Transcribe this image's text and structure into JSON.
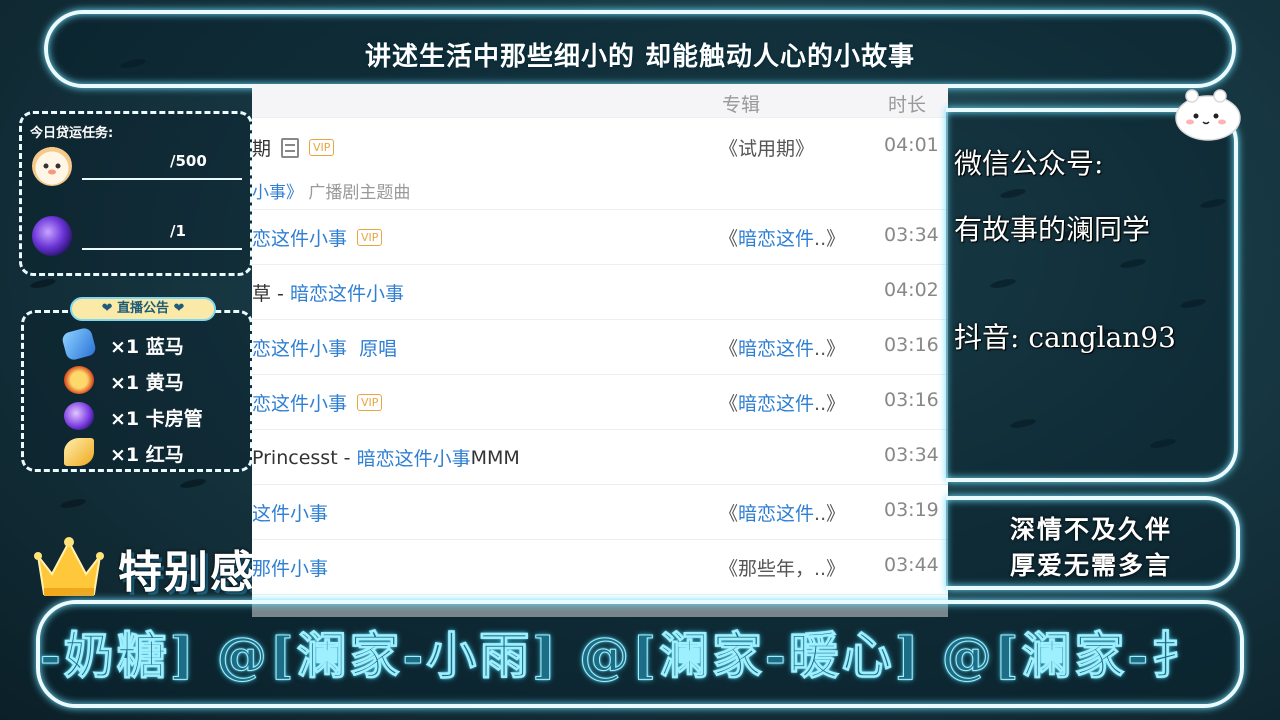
{
  "top_banner": {
    "title": "讲述生活中那些细小的 却能触动人心的小故事"
  },
  "task_panel": {
    "title": "今日贷运任务:",
    "rows": [
      {
        "icon": "chick-avatar-icon",
        "count": "/500"
      },
      {
        "icon": "purple-orb-icon",
        "count": "/1"
      }
    ]
  },
  "notice_panel": {
    "badge": "❤ 直播公告 ❤",
    "items": [
      {
        "icon": "ticket-icon",
        "text": "×1 蓝马"
      },
      {
        "icon": "crown-gift-icon",
        "text": "×1 黄马"
      },
      {
        "icon": "purple-gem-icon",
        "text": "×1 卡房管"
      },
      {
        "icon": "wing-icon",
        "text": "×1 红马"
      }
    ]
  },
  "special": {
    "label": "特别感"
  },
  "music_list": {
    "header": {
      "album": "专辑",
      "duration": "时长"
    },
    "rows": [
      {
        "title_plain": "期",
        "title_blue": "",
        "title_suffix": "",
        "vip": "VIP",
        "mv": true,
        "subtitle_blue": "小事》",
        "subtitle_gray": "广播剧主题曲",
        "album_plain": "《试用期》",
        "album_blue": "",
        "album_suffix": "",
        "duration": "04:01"
      },
      {
        "title_plain": "",
        "title_blue": "恋这件小事",
        "title_suffix": "",
        "vip": "VIP",
        "album_plain": "《",
        "album_blue": "暗恋这件",
        "album_suffix": "..》",
        "duration": "03:34"
      },
      {
        "title_plain": "草 - ",
        "title_blue": "暗恋这件小事",
        "title_suffix": "",
        "vip": "",
        "album_plain": "",
        "album_blue": "",
        "album_suffix": "",
        "duration": "04:02"
      },
      {
        "title_plain": "",
        "title_blue": "恋这件小事  原唱",
        "title_suffix": "",
        "vip": "",
        "album_plain": "《",
        "album_blue": "暗恋这件",
        "album_suffix": "..》",
        "duration": "03:16"
      },
      {
        "title_plain": "",
        "title_blue": "恋这件小事",
        "title_suffix": "",
        "vip": "VIP",
        "album_plain": "《",
        "album_blue": "暗恋这件",
        "album_suffix": "..》",
        "duration": "03:16"
      },
      {
        "title_plain": "Princesst - ",
        "title_blue": "暗恋这件小事",
        "title_suffix": "MMM",
        "vip": "",
        "album_plain": "",
        "album_blue": "",
        "album_suffix": "",
        "duration": "03:34"
      },
      {
        "title_plain": "",
        "title_blue": "这件小事",
        "title_suffix": "",
        "vip": "",
        "album_plain": "《",
        "album_blue": "暗恋这件",
        "album_suffix": "..》",
        "duration": "03:19"
      },
      {
        "title_plain": "",
        "title_blue": "那件小事",
        "title_suffix": "",
        "vip": "",
        "album_plain": "《那些年，..》",
        "album_blue": "",
        "album_suffix": "",
        "duration": "03:44"
      }
    ]
  },
  "info_panel": {
    "wechat_label": "微信公众号:",
    "wechat_name": "有故事的澜同学",
    "douyin": "抖音: canglan93"
  },
  "motto": {
    "line1": "深情不及久伴",
    "line2": "厚爱无需多言"
  },
  "marquee": {
    "text": "-奶糖] @[澜家-小雨] @[澜家-暖心] @[澜家-扌"
  },
  "colors": {
    "neon_border": "#e9fbff",
    "glow": "#6fe0ff",
    "link_blue": "#2f7fd3",
    "vip_orange": "#e8a640"
  }
}
